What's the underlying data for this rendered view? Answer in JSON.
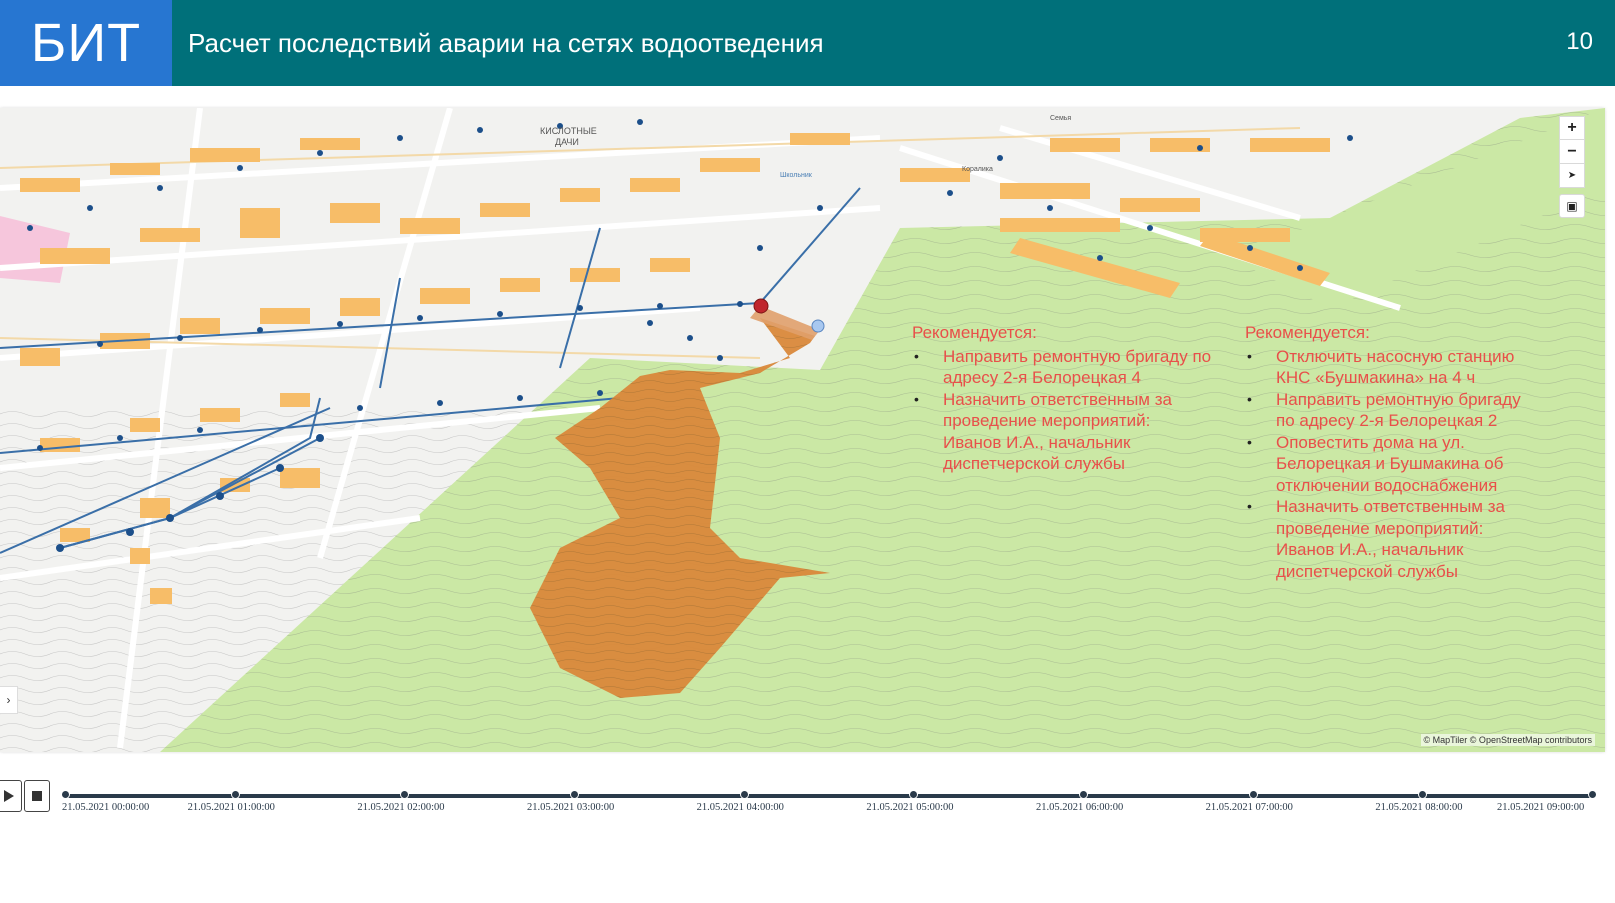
{
  "header": {
    "logo": "БИТ",
    "title": "Расчет последствий аварии на сетях водоотведения",
    "slide_number": "10"
  },
  "map": {
    "labels": [
      "КИСЛОТНЫЕ",
      "ДАЧИ",
      "Школьник",
      "Коралика",
      "Семья"
    ],
    "attribution": "© MapTiler © OpenStreetMap contributors",
    "controls": {
      "zoom_in": "+",
      "zoom_out": "−",
      "compass": "➤",
      "layers": "▣"
    },
    "side_toggle": "›",
    "colors": {
      "terrain": "#cbe8a5",
      "urban": "#f2f2f0",
      "buildings": "#f7bd68",
      "pipes": "#1c4f8a",
      "flood": "#d9883a",
      "accident": "#c0262d"
    }
  },
  "recommendations": [
    {
      "title": "Рекомендуется:",
      "items": [
        "Направить ремонтную бригаду по адресу 2-я Белорецкая 4",
        "Назначить ответственным за проведение мероприятий: Иванов И.А., начальник диспетчерской службы"
      ]
    },
    {
      "title": "Рекомендуется:",
      "items": [
        "Отключить насосную станцию КНС «Бушмакина» на 4 ч",
        "Направить ремонтную бригаду по адресу 2-я Белорецкая 2",
        "Оповестить дома на ул. Белорецкая и Бушмакина об отключении водоснабжения",
        "Назначить ответственным за проведение мероприятий: Иванов И.А., начальник диспетчерской службы"
      ]
    }
  ],
  "timeline": {
    "play_icon": "play-icon",
    "stop_icon": "stop-icon",
    "labels": [
      "21.05.2021 00:00:00",
      "21.05.2021 01:00:00",
      "21.05.2021 02:00:00",
      "21.05.2021 03:00:00",
      "21.05.2021 04:00:00",
      "21.05.2021 05:00:00",
      "21.05.2021 06:00:00",
      "21.05.2021 07:00:00",
      "21.05.2021 08:00:00",
      "21.05.2021 09:00:00"
    ]
  }
}
